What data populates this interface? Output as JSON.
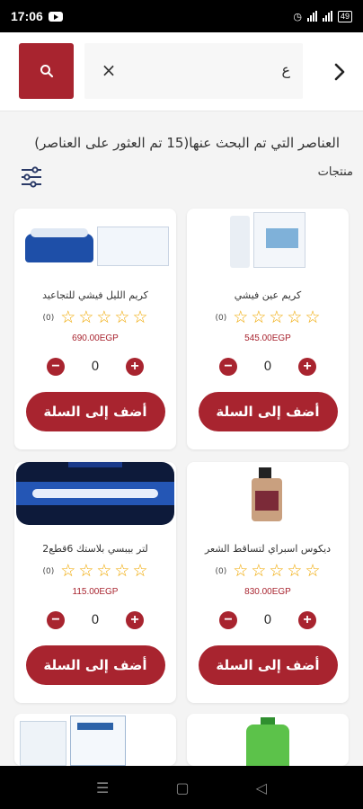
{
  "status": {
    "time": "17:06",
    "battery": "49"
  },
  "header": {
    "search_value": "ع",
    "clear_icon": "×"
  },
  "results": {
    "title": "العناصر التي تم البحث عنها(15 تم العثور على العناصر)",
    "section_label": "منتجات"
  },
  "products": [
    {
      "name": "كريم عين فيشي",
      "rating_count": "(0)",
      "price": "545.00EGP",
      "qty": "0",
      "cart_label": "أضف إلى السلة"
    },
    {
      "name": "كريم الليل فيشي للتجاعيد",
      "rating_count": "(0)",
      "price": "690.00EGP",
      "qty": "0",
      "cart_label": "أضف إلى السلة"
    },
    {
      "name": "ديكوس اسبراي لتساقط الشعر",
      "rating_count": "(0)",
      "price": "830.00EGP",
      "qty": "0",
      "cart_label": "أضف إلى السلة"
    },
    {
      "name": "2لتر بيبسي بلاستك 6قطع",
      "rating_count": "(0)",
      "price": "115.00EGP",
      "qty": "0",
      "cart_label": "أضف إلى السلة"
    }
  ],
  "nav": {
    "recents": "☰",
    "home": "▢",
    "back": "◁"
  },
  "colors": {
    "brand": "#a8242f",
    "star": "#f0a800"
  }
}
